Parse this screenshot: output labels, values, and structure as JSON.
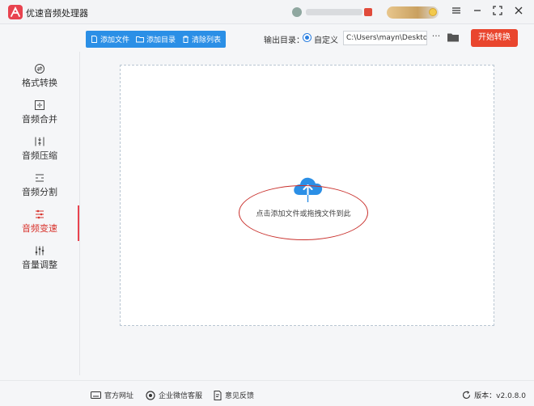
{
  "app": {
    "title": "优速音频处理器",
    "accent": "#e8434f"
  },
  "window": {
    "menu_icon": "hamburger-icon",
    "minimize_icon": "minimize-icon",
    "maximize_icon": "fullscreen-icon",
    "close_icon": "close-icon"
  },
  "sidebar": {
    "items": [
      {
        "label": "格式转换",
        "icon": "format-convert-icon",
        "active": false
      },
      {
        "label": "音频合并",
        "icon": "merge-icon",
        "active": false
      },
      {
        "label": "音频压缩",
        "icon": "compress-icon",
        "active": false
      },
      {
        "label": "音频分割",
        "icon": "split-icon",
        "active": false
      },
      {
        "label": "音频变速",
        "icon": "speed-icon",
        "active": true
      },
      {
        "label": "音量调整",
        "icon": "volume-adjust-icon",
        "active": false
      }
    ]
  },
  "toolbar": {
    "add_file": "添加文件",
    "add_folder": "添加目录",
    "clear_list": "清除列表",
    "output_label": "输出目录：",
    "custom_label": "自定义",
    "output_path": "C:\\Users\\mayn\\Desktop",
    "more_label": "···",
    "start_label": "开始转换",
    "start_color": "#e9462e",
    "group_color": "#2b8fe6"
  },
  "dropzone": {
    "hint": "点击添加文件或拖拽文件到此",
    "icon": "cloud-upload-icon"
  },
  "footer": {
    "website": "官方网址",
    "wechat": "企业微信客服",
    "feedback": "意见反馈",
    "version": "版本：v2.0.8.0"
  }
}
